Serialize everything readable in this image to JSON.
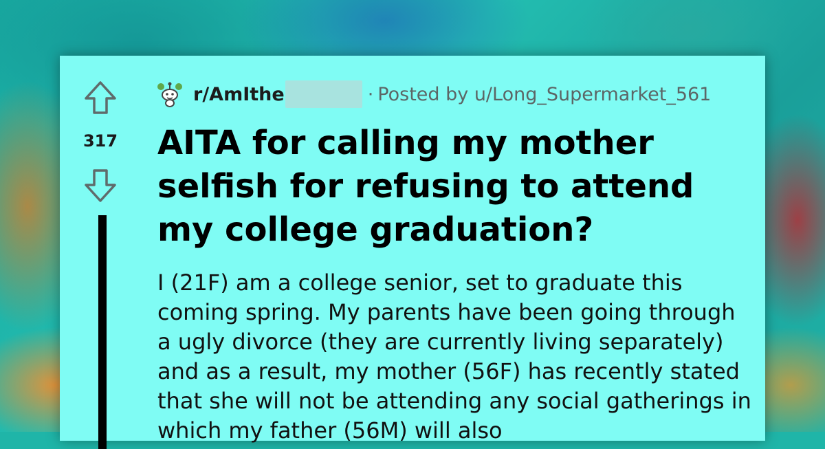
{
  "post": {
    "score": "317",
    "subreddit": "r/AmIthe",
    "separator": "·",
    "posted_by": "Posted by u/Long_Supermarket_561",
    "title": "AITA for calling my mother selfish for refusing to attend my college graduation?",
    "body": "I (21F) am a college senior, set to graduate this coming spring. My parents have been going through a ugly divorce (they are currently living separately) and as a result, my mother (56F) has recently stated that she will not be attending any social gatherings in which my father (56M) will also"
  },
  "icons": {
    "upvote": "upvote-arrow-icon",
    "downvote": "downvote-arrow-icon",
    "subreddit": "snoo-icon"
  },
  "colors": {
    "card_background": "#7ffcf4",
    "thread_line": "#000000",
    "meta_text": "#5c6666"
  }
}
